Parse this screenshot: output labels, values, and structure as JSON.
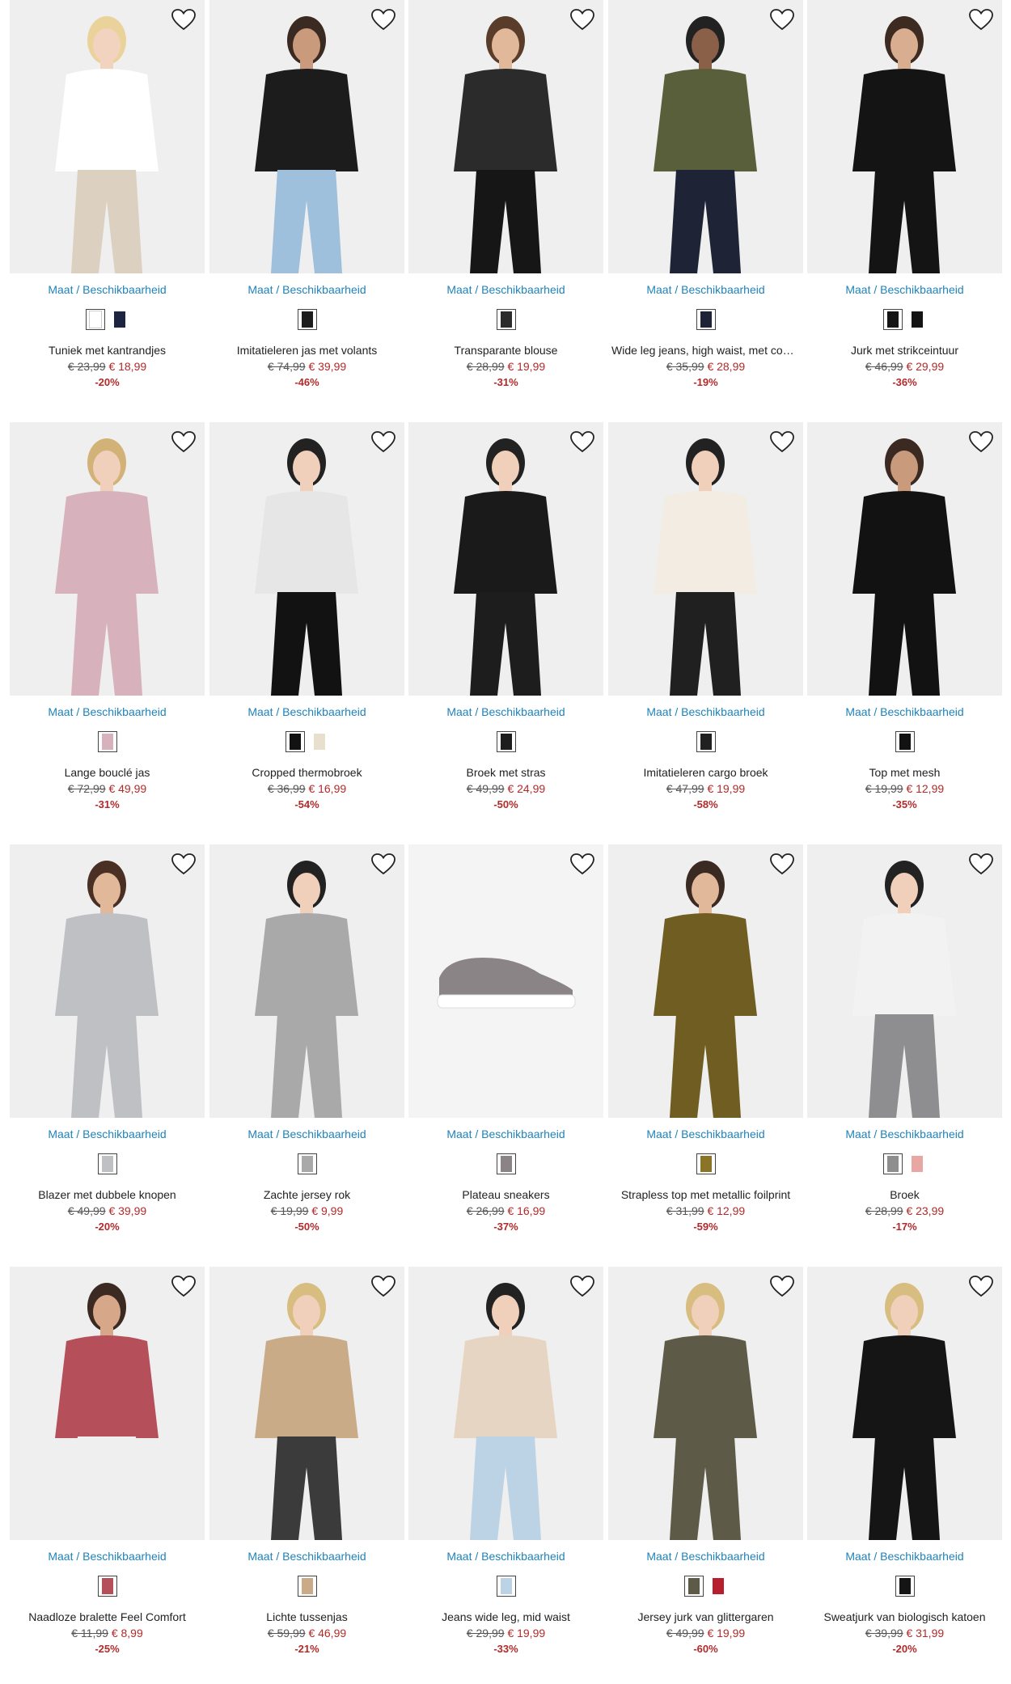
{
  "size_label": "Maat / Beschikbaarheid",
  "wishlist_icon": "heart-outline-icon",
  "products": [
    {
      "name": "Tuniek met kantrandjes",
      "old_price": "€ 23,99",
      "new_price": "€ 18,99",
      "discount": "-20%",
      "bg": "#efefef",
      "top": "#ffffff",
      "bottom": "#dcd0c0",
      "skin": "#f1d3bf",
      "hair": "#e9d39a",
      "swatches": [
        "#ffffff",
        "#1b2440"
      ]
    },
    {
      "name": "Imitatieleren jas met volants",
      "old_price": "€ 74,99",
      "new_price": "€ 39,99",
      "discount": "-46%",
      "bg": "#efefef",
      "top": "#1c1c1c",
      "bottom": "#9ec0dd",
      "skin": "#c99b7c",
      "hair": "#3b2a22",
      "swatches": [
        "#1c1c1c"
      ]
    },
    {
      "name": "Transparante blouse",
      "old_price": "€ 28,99",
      "new_price": "€ 19,99",
      "discount": "-31%",
      "bg": "#efefef",
      "top": "#2b2b2b",
      "bottom": "#161616",
      "skin": "#e2b89a",
      "hair": "#5a3c2a",
      "swatches": [
        "#2b2b2b"
      ]
    },
    {
      "name": "Wide leg jeans, high waist, met com…",
      "old_price": "€ 35,99",
      "new_price": "€ 28,99",
      "discount": "-19%",
      "bg": "#efefef",
      "top": "#5a5f3b",
      "bottom": "#1e2436",
      "skin": "#8a6048",
      "hair": "#222",
      "swatches": [
        "#1e2436"
      ]
    },
    {
      "name": "Jurk met strikceintuur",
      "old_price": "€ 46,99",
      "new_price": "€ 29,99",
      "discount": "-36%",
      "bg": "#efefef",
      "top": "#141414",
      "bottom": "#141414",
      "skin": "#d9ad90",
      "hair": "#3d2a20",
      "swatches": [
        "#141414",
        "#141414"
      ]
    },
    {
      "name": "Lange bouclé jas",
      "old_price": "€ 72,99",
      "new_price": "€ 49,99",
      "discount": "-31%",
      "bg": "#efefef",
      "top": "#d7b2bc",
      "bottom": "#d7b2bc",
      "skin": "#f0d0ba",
      "hair": "#d2b277",
      "swatches": [
        "#d7b2bc"
      ]
    },
    {
      "name": "Cropped thermobroek",
      "old_price": "€ 36,99",
      "new_price": "€ 16,99",
      "discount": "-54%",
      "bg": "#efefef",
      "top": "#e6e6e6",
      "bottom": "#121212",
      "skin": "#f0d0ba",
      "hair": "#222",
      "swatches": [
        "#121212",
        "#e8e0cc"
      ]
    },
    {
      "name": "Broek met stras",
      "old_price": "€ 49,99",
      "new_price": "€ 24,99",
      "discount": "-50%",
      "bg": "#efefef",
      "top": "#1a1a1a",
      "bottom": "#1d1d1d",
      "skin": "#f0d0ba",
      "hair": "#222",
      "swatches": [
        "#1d1d1d"
      ]
    },
    {
      "name": "Imitatieleren cargo broek",
      "old_price": "€ 47,99",
      "new_price": "€ 19,99",
      "discount": "-58%",
      "bg": "#efefef",
      "top": "#f2ece2",
      "bottom": "#202020",
      "skin": "#f0d0ba",
      "hair": "#222",
      "swatches": [
        "#202020"
      ]
    },
    {
      "name": "Top met mesh",
      "old_price": "€ 19,99",
      "new_price": "€ 12,99",
      "discount": "-35%",
      "bg": "#efefef",
      "top": "#121212",
      "bottom": "#121212",
      "skin": "#c99b7c",
      "hair": "#3b2a22",
      "swatches": [
        "#121212"
      ]
    },
    {
      "name": "Blazer met dubbele knopen",
      "old_price": "€ 49,99",
      "new_price": "€ 39,99",
      "discount": "-20%",
      "bg": "#efefef",
      "top": "#bfc0c3",
      "bottom": "#bfc0c3",
      "skin": "#e2b89a",
      "hair": "#4a3024",
      "swatches": [
        "#bfc0c3"
      ]
    },
    {
      "name": "Zachte jersey rok",
      "old_price": "€ 19,99",
      "new_price": "€ 9,99",
      "discount": "-50%",
      "bg": "#efefef",
      "top": "#a9a9a9",
      "bottom": "#a9a9a9",
      "skin": "#f0d0ba",
      "hair": "#222",
      "swatches": [
        "#a9a9a9"
      ]
    },
    {
      "name": "Plateau sneakers",
      "old_price": "€ 26,99",
      "new_price": "€ 16,99",
      "discount": "-37%",
      "bg": "#f4f4f4",
      "top": "#8a8486",
      "bottom": "#8a8486",
      "skin": "#f4f4f4",
      "hair": "#f4f4f4",
      "swatches": [
        "#8a8486"
      ]
    },
    {
      "name": "Strapless top met metallic foilprint",
      "old_price": "€ 31,99",
      "new_price": "€ 12,99",
      "discount": "-59%",
      "bg": "#efefef",
      "top": "#6f5d22",
      "bottom": "#6f5d22",
      "skin": "#e2b89a",
      "hair": "#3b2a22",
      "swatches": [
        "#8a7428"
      ]
    },
    {
      "name": "Broek",
      "old_price": "€ 28,99",
      "new_price": "€ 23,99",
      "discount": "-17%",
      "bg": "#efefef",
      "top": "#f2f2f2",
      "bottom": "#8e8e90",
      "skin": "#f0d0ba",
      "hair": "#222",
      "swatches": [
        "#8e8e90",
        "#e9a7a4"
      ]
    },
    {
      "name": "Naadloze bralette Feel Comfort",
      "old_price": "€ 11,99",
      "new_price": "€ 8,99",
      "discount": "-25%",
      "bg": "#efefef",
      "top": "#b5505b",
      "bottom": "#efefef",
      "skin": "#d7a789",
      "hair": "#3b2a22",
      "swatches": [
        "#b5505b"
      ]
    },
    {
      "name": "Lichte tussenjas",
      "old_price": "€ 59,99",
      "new_price": "€ 46,99",
      "discount": "-21%",
      "bg": "#efefef",
      "top": "#c9ab87",
      "bottom": "#3b3b3b",
      "skin": "#f0d0ba",
      "hair": "#d8bd80",
      "swatches": [
        "#c9ab87"
      ]
    },
    {
      "name": "Jeans wide leg, mid waist",
      "old_price": "€ 29,99",
      "new_price": "€ 19,99",
      "discount": "-33%",
      "bg": "#efefef",
      "top": "#e6d5c2",
      "bottom": "#bcd3e6",
      "skin": "#f0d0ba",
      "hair": "#222",
      "swatches": [
        "#bcd3e6"
      ]
    },
    {
      "name": "Jersey jurk van glittergaren",
      "old_price": "€ 49,99",
      "new_price": "€ 19,99",
      "discount": "-60%",
      "bg": "#efefef",
      "top": "#5d5a48",
      "bottom": "#5d5a48",
      "skin": "#f0d0ba",
      "hair": "#d8bd80",
      "swatches": [
        "#5d5a48",
        "#b71f2f"
      ]
    },
    {
      "name": "Sweatjurk van biologisch katoen",
      "old_price": "€ 39,99",
      "new_price": "€ 31,99",
      "discount": "-20%",
      "bg": "#efefef",
      "top": "#151515",
      "bottom": "#151515",
      "skin": "#f0d0ba",
      "hair": "#d8bd80",
      "swatches": [
        "#151515"
      ]
    }
  ]
}
